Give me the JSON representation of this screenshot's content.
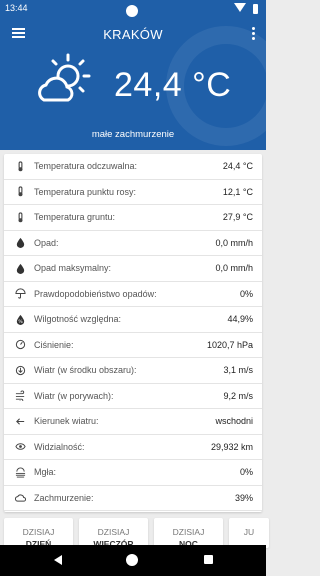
{
  "status_bar": {
    "time": "13:44"
  },
  "header": {
    "city": "KRAKÓW",
    "temperature": "24,4 °C",
    "description": "małe zachmurzenie",
    "weather_icon": "sun-behind-cloud-icon"
  },
  "details": [
    {
      "icon": "thermometer-icon",
      "label": "Temperatura odczuwalna:",
      "value": "24,4 °C"
    },
    {
      "icon": "thermometer-icon",
      "label": "Temperatura punktu rosy:",
      "value": "12,1 °C"
    },
    {
      "icon": "thermometer-icon",
      "label": "Temperatura gruntu:",
      "value": "27,9 °C"
    },
    {
      "icon": "drop-icon",
      "label": "Opad:",
      "value": "0,0 mm/h"
    },
    {
      "icon": "drop-icon",
      "label": "Opad maksymalny:",
      "value": "0,0 mm/h"
    },
    {
      "icon": "umbrella-icon",
      "label": "Prawdopodobieństwo opadów:",
      "value": "0%"
    },
    {
      "icon": "humidity-icon",
      "label": "Wilgotność względna:",
      "value": "44,9%"
    },
    {
      "icon": "gauge-icon",
      "label": "Ciśnienie:",
      "value": "1020,7 hPa"
    },
    {
      "icon": "wind-center-icon",
      "label": "Wiatr (w środku obszaru):",
      "value": "3,1 m/s"
    },
    {
      "icon": "wind-gust-icon",
      "label": "Wiatr (w porywach):",
      "value": "9,2 m/s"
    },
    {
      "icon": "arrow-left-icon",
      "label": "Kierunek wiatru:",
      "value": "wschodni"
    },
    {
      "icon": "visibility-icon",
      "label": "Widzialność:",
      "value": "29,932 km"
    },
    {
      "icon": "fog-icon",
      "label": "Mgła:",
      "value": "0%"
    },
    {
      "icon": "cloud-icon",
      "label": "Zachmurzenie:",
      "value": "39%"
    }
  ],
  "forecast_tabs": [
    {
      "line1": "DZISIAJ",
      "line2": "DZIEŃ"
    },
    {
      "line1": "DZISIAJ",
      "line2": "WIECZÓR"
    },
    {
      "line1": "DZISIAJ",
      "line2": "NOC"
    },
    {
      "line1": "JU",
      "line2": ""
    }
  ],
  "colors": {
    "brand_blue": "#1f5fa8"
  }
}
